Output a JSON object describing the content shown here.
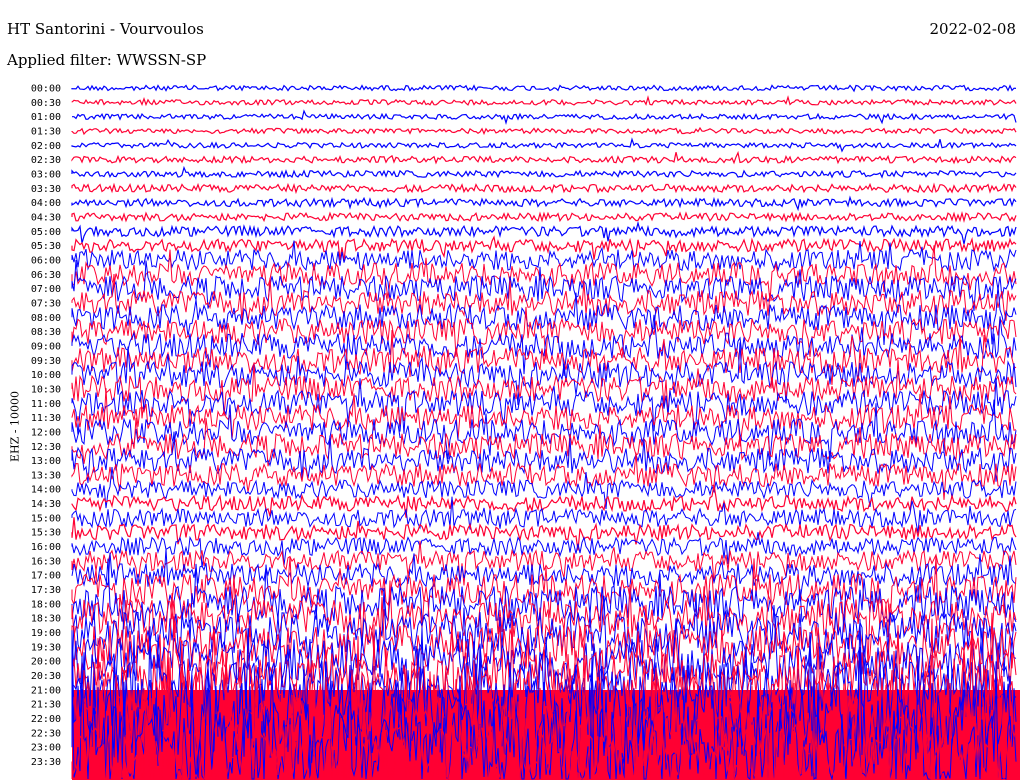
{
  "header": {
    "station": "HT Santorini - Vourvoulos",
    "date": "2022-02-08",
    "filter": "Applied filter: WWSSN-SP"
  },
  "chart_data": {
    "type": "line",
    "title": "HT Santorini - Vourvoulos",
    "subtitle": "Applied filter: WWSSN-SP",
    "ylabel": "EHZ - 10000",
    "xlabel": "",
    "colors": {
      "even_rows": "#0000ff",
      "odd_rows": "#ff0033"
    },
    "row_labels": [
      "00:00",
      "00:30",
      "01:00",
      "01:30",
      "02:00",
      "02:30",
      "03:00",
      "03:30",
      "04:00",
      "04:30",
      "05:00",
      "05:30",
      "06:00",
      "06:30",
      "07:00",
      "07:30",
      "08:00",
      "08:30",
      "09:00",
      "09:30",
      "10:00",
      "10:30",
      "11:00",
      "11:30",
      "12:00",
      "12:30",
      "13:00",
      "13:30",
      "14:00",
      "14:30",
      "15:00",
      "15:30",
      "16:00",
      "16:30",
      "17:00",
      "17:30",
      "18:00",
      "18:30",
      "19:00",
      "19:30",
      "20:00",
      "20:30",
      "21:00",
      "21:30",
      "22:00",
      "22:30",
      "23:00",
      "23:30"
    ],
    "activity_level": [
      0.2,
      0.2,
      0.2,
      0.2,
      0.2,
      0.25,
      0.25,
      0.3,
      0.3,
      0.3,
      0.4,
      0.5,
      0.8,
      0.9,
      1.0,
      1.0,
      1.0,
      1.0,
      1.0,
      1.0,
      1.0,
      1.0,
      1.0,
      1.0,
      1.0,
      1.0,
      1.0,
      0.9,
      0.7,
      0.6,
      0.7,
      0.6,
      0.7,
      0.8,
      0.9,
      1.2,
      1.4,
      1.5,
      1.6,
      1.7,
      1.8,
      2.0,
      2.2,
      3.0,
      3.0,
      3.0,
      3.0,
      3.0
    ]
  }
}
